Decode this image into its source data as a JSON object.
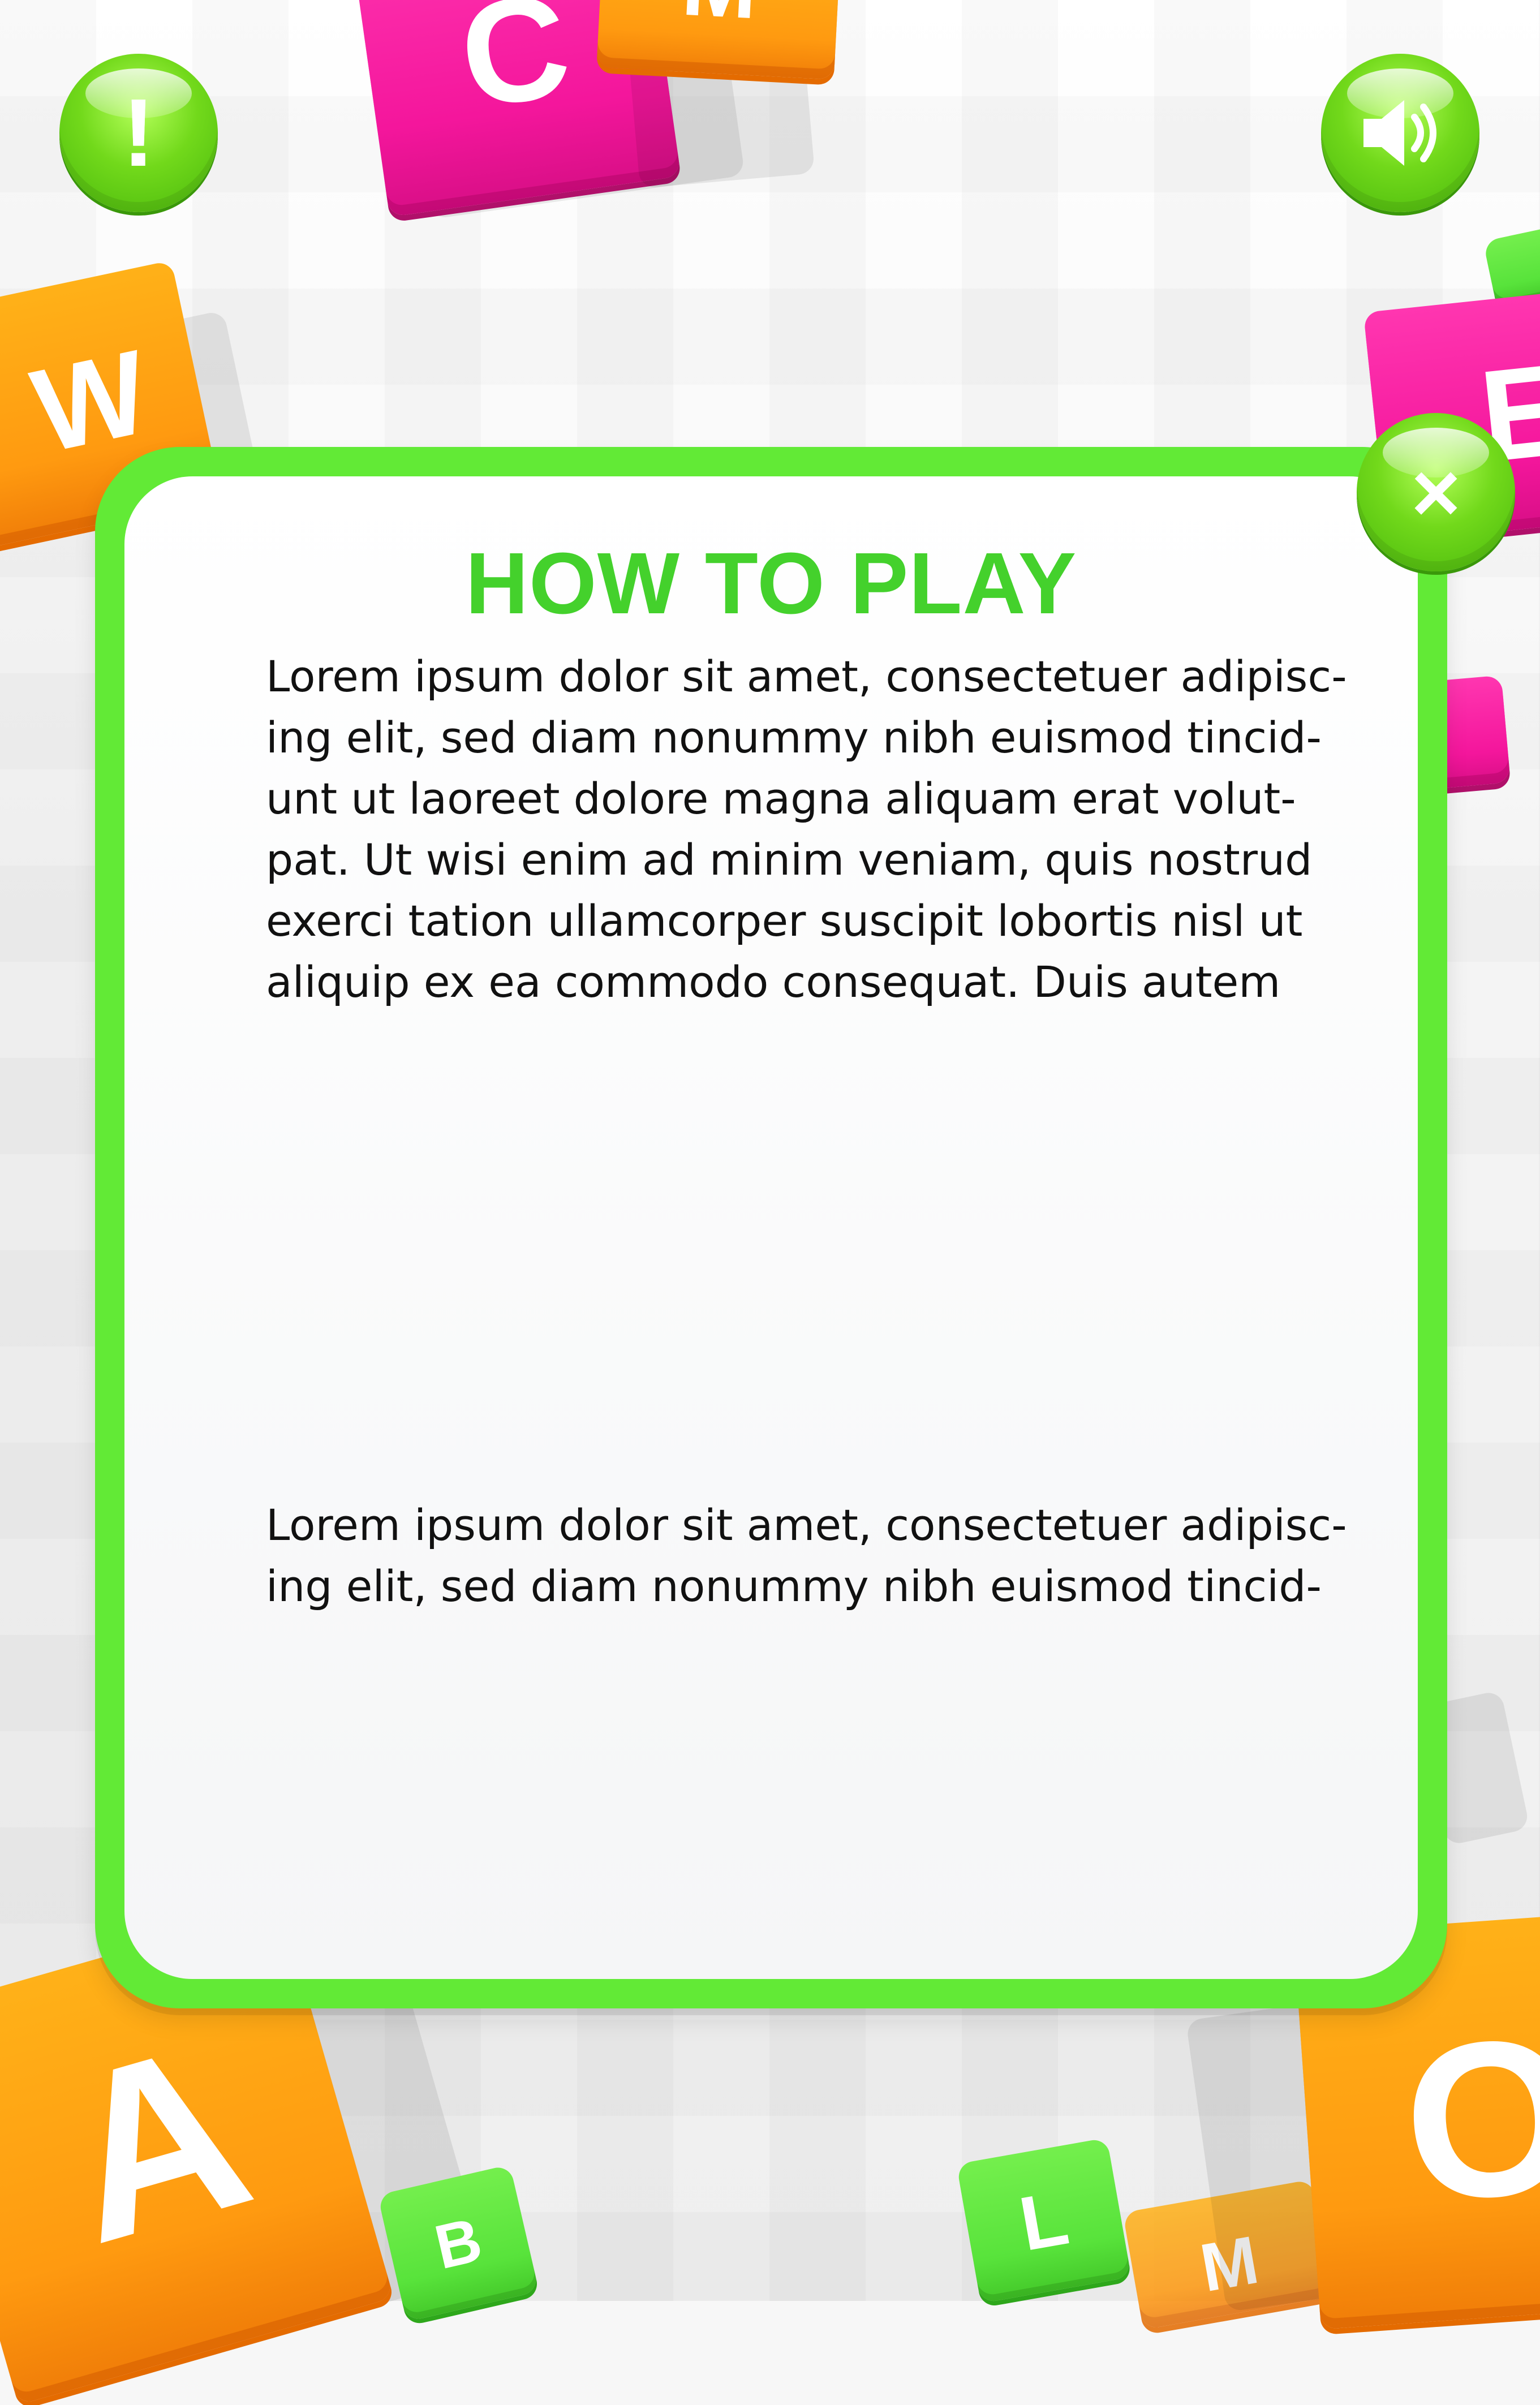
{
  "screen": {
    "title": "HOW TO PLAY",
    "paragraph_1": [
      "Lorem ipsum dolor sit amet, consectetuer adipisc-",
      "ing elit, sed diam nonummy nibh euismod tincid-",
      "unt ut laoreet dolore magna aliquam erat volut-",
      "pat. Ut wisi enim ad minim veniam, quis nostrud",
      "exerci tation ullamcorper suscipit lobortis nisl ut",
      "aliquip ex ea commodo consequat. Duis autem"
    ],
    "paragraph_2": [
      "Lorem ipsum dolor sit amet, consectetuer adipisc-",
      "ing elit, sed diam nonummy nibh euismod tincid-"
    ]
  },
  "buttons": {
    "info_icon": "!",
    "sound_icon": "speaker-icon",
    "close_icon": "×"
  },
  "tiles": {
    "c": "C",
    "m_top": "M",
    "w": "W",
    "e": "E",
    "a": "A",
    "b": "B",
    "l": "L",
    "m_bottom": "M",
    "o": "O"
  },
  "colors": {
    "green_primary": "#62ea36",
    "orange_tile": "#ff9a10",
    "pink_tile": "#f4169c",
    "title_green": "#44d12c"
  }
}
